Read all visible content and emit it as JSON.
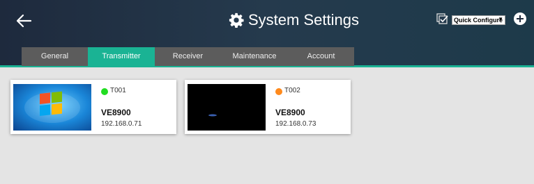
{
  "header": {
    "title": "System Settings",
    "quick_configure": "Quick Configure"
  },
  "tabs": [
    {
      "label": "General",
      "active": false
    },
    {
      "label": "Transmitter",
      "active": true
    },
    {
      "label": "Receiver",
      "active": false
    },
    {
      "label": "Maintenance",
      "active": false
    },
    {
      "label": "Account",
      "active": false
    }
  ],
  "devices": [
    {
      "id": "T001",
      "model": "VE8900",
      "ip": "192.168.0.71",
      "status_color": "#22dd22"
    },
    {
      "id": "T002",
      "model": "VE8900",
      "ip": "192.168.0.73",
      "status_color": "#ff8a1c"
    }
  ],
  "colors": {
    "accent": "#1ab394",
    "tab_inactive": "#5c5c5c"
  }
}
